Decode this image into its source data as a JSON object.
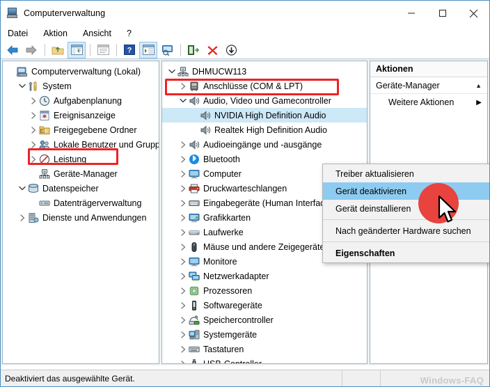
{
  "window": {
    "title": "Computerverwaltung",
    "icon": "computer-management-icon",
    "minimize_label": "–",
    "maximize_label": "☐",
    "close_label": "✕"
  },
  "menubar": {
    "items": [
      {
        "label": "Datei"
      },
      {
        "label": "Aktion"
      },
      {
        "label": "Ansicht"
      },
      {
        "label": "?"
      }
    ]
  },
  "toolbar": {
    "items": [
      {
        "name": "back-icon",
        "tooltip": "Zurück"
      },
      {
        "name": "forward-icon",
        "tooltip": "Vorwärts"
      },
      {
        "name": "up-folder-icon",
        "tooltip": "Eine Ebene höher"
      },
      {
        "name": "show-hide-console-tree-icon",
        "tooltip": "Konsolenstruktur ein-/ausblenden"
      },
      {
        "name": "properties-icon",
        "tooltip": "Eigenschaften"
      },
      {
        "name": "help-icon",
        "tooltip": "Hilfe"
      },
      {
        "name": "show-hide-action-pane-icon",
        "tooltip": "Aktionsbereich ein-/ausblenden"
      },
      {
        "name": "scan-hardware-icon",
        "tooltip": "Nach geänderter Hardware suchen"
      },
      {
        "name": "update-driver-icon",
        "tooltip": "Treiber aktualisieren"
      },
      {
        "name": "disable-device-icon",
        "tooltip": "Gerät deaktivieren"
      },
      {
        "name": "install-device-icon",
        "tooltip": "Gerät installieren"
      }
    ]
  },
  "left_tree": {
    "root": {
      "label": "Computerverwaltung (Lokal)",
      "icon": "computer-icon",
      "indent": 0,
      "twisty": "none"
    },
    "items": [
      {
        "label": "System",
        "icon": "tools-icon",
        "indent": 1,
        "twisty": "expanded"
      },
      {
        "label": "Aufgabenplanung",
        "icon": "clock-icon",
        "indent": 2,
        "twisty": "collapsed"
      },
      {
        "label": "Ereignisanzeige",
        "icon": "event-log-icon",
        "indent": 2,
        "twisty": "collapsed"
      },
      {
        "label": "Freigegebene Ordner",
        "icon": "shared-folder-icon",
        "indent": 2,
        "twisty": "collapsed"
      },
      {
        "label": "Lokale Benutzer und Gruppen",
        "icon": "users-icon",
        "indent": 2,
        "twisty": "collapsed"
      },
      {
        "label": "Leistung",
        "icon": "performance-icon",
        "indent": 2,
        "twisty": "collapsed"
      },
      {
        "label": "Geräte-Manager",
        "icon": "device-manager-icon",
        "indent": 2,
        "twisty": "none",
        "highlighted": true
      },
      {
        "label": "Datenspeicher",
        "icon": "storage-icon",
        "indent": 1,
        "twisty": "expanded"
      },
      {
        "label": "Datenträgerverwaltung",
        "icon": "disk-management-icon",
        "indent": 2,
        "twisty": "none"
      },
      {
        "label": "Dienste und Anwendungen",
        "icon": "services-icon",
        "indent": 1,
        "twisty": "collapsed"
      }
    ]
  },
  "device_tree": {
    "root": {
      "label": "DHMUCW113",
      "icon": "computer-node-icon",
      "indent": 0,
      "twisty": "expanded"
    },
    "items": [
      {
        "label": "Anschlüsse (COM & LPT)",
        "icon": "port-icon",
        "indent": 1,
        "twisty": "collapsed"
      },
      {
        "label": "Audio, Video und Gamecontroller",
        "icon": "speaker-icon",
        "indent": 1,
        "twisty": "expanded",
        "highlighted": true
      },
      {
        "label": "NVIDIA High Definition Audio",
        "icon": "speaker-icon",
        "indent": 2,
        "twisty": "none",
        "selected": true
      },
      {
        "label": "Realtek High Definition Audio",
        "icon": "speaker-icon",
        "indent": 2,
        "twisty": "none"
      },
      {
        "label": "Audioeingänge und -ausgänge",
        "icon": "speaker-icon",
        "indent": 1,
        "twisty": "collapsed"
      },
      {
        "label": "Bluetooth",
        "icon": "bluetooth-icon",
        "indent": 1,
        "twisty": "collapsed"
      },
      {
        "label": "Computer",
        "icon": "monitor-icon",
        "indent": 1,
        "twisty": "collapsed"
      },
      {
        "label": "Druckwarteschlangen",
        "icon": "printer-icon",
        "indent": 1,
        "twisty": "collapsed"
      },
      {
        "label": "Eingabegeräte (Human Interface Devices)",
        "icon": "hid-icon",
        "indent": 1,
        "twisty": "collapsed"
      },
      {
        "label": "Grafikkarten",
        "icon": "display-adapter-icon",
        "indent": 1,
        "twisty": "collapsed"
      },
      {
        "label": "Laufwerke",
        "icon": "drive-icon",
        "indent": 1,
        "twisty": "collapsed"
      },
      {
        "label": "Mäuse und andere Zeigegeräte",
        "icon": "mouse-icon",
        "indent": 1,
        "twisty": "collapsed"
      },
      {
        "label": "Monitore",
        "icon": "monitor-icon",
        "indent": 1,
        "twisty": "collapsed"
      },
      {
        "label": "Netzwerkadapter",
        "icon": "network-adapter-icon",
        "indent": 1,
        "twisty": "collapsed"
      },
      {
        "label": "Prozessoren",
        "icon": "cpu-icon",
        "indent": 1,
        "twisty": "collapsed"
      },
      {
        "label": "Softwaregeräte",
        "icon": "software-device-icon",
        "indent": 1,
        "twisty": "collapsed"
      },
      {
        "label": "Speichercontroller",
        "icon": "storage-controller-icon",
        "indent": 1,
        "twisty": "collapsed"
      },
      {
        "label": "Systemgeräte",
        "icon": "system-device-icon",
        "indent": 1,
        "twisty": "collapsed"
      },
      {
        "label": "Tastaturen",
        "icon": "keyboard-icon",
        "indent": 1,
        "twisty": "collapsed"
      },
      {
        "label": "USB-Controller",
        "icon": "usb-icon",
        "indent": 1,
        "twisty": "collapsed"
      }
    ]
  },
  "actions_pane": {
    "header": "Aktionen",
    "group_label": "Geräte-Manager",
    "group_caret": "▲",
    "sub_label": "Weitere Aktionen",
    "sub_arrow": "▶"
  },
  "context_menu": {
    "items": [
      {
        "label": "Treiber aktualisieren",
        "highlighted": false,
        "bold": false
      },
      {
        "label": "Gerät deaktivieren",
        "highlighted": true,
        "bold": false
      },
      {
        "label": "Gerät deinstallieren",
        "highlighted": false,
        "bold": false
      },
      {
        "separator": true
      },
      {
        "label": "Nach geänderter Hardware suchen",
        "highlighted": false,
        "bold": false
      },
      {
        "separator": true
      },
      {
        "label": "Eigenschaften",
        "highlighted": false,
        "bold": true
      }
    ]
  },
  "statusbar": {
    "text": "Deaktiviert das ausgewählte Gerät.",
    "watermark": "Windows-FAQ"
  },
  "colors": {
    "window_border": "#4a8ec2",
    "selection_blue": "#cde8f7",
    "menu_highlight": "#8ecbf0",
    "annotation_red": "#ee2222",
    "click_dot": "#e8433f"
  }
}
